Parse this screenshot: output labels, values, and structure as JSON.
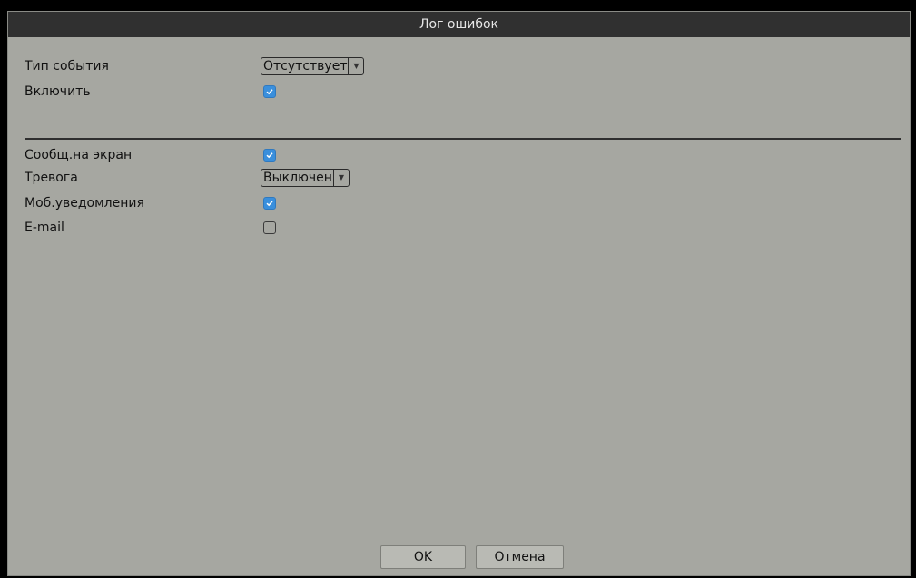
{
  "window": {
    "title": "Лог ошибок"
  },
  "settings_top": {
    "event_type": {
      "label": "Тип события",
      "value": "Отсутствует"
    },
    "enable": {
      "label": "Включить",
      "checked": true
    }
  },
  "settings_bottom": {
    "show_message": {
      "label": "Сообщ.на экран",
      "checked": true
    },
    "alarm": {
      "label": "Тревога",
      "value": "Выключен"
    },
    "mobile_notify": {
      "label": "Моб.уведомления",
      "checked": true
    },
    "email": {
      "label": "E-mail",
      "checked": false
    }
  },
  "buttons": {
    "ok_label": "OK",
    "cancel_label": "Отмена"
  },
  "colors": {
    "panel_bg": "#a6a7a1",
    "titlebar_bg": "#303030",
    "checkbox_on": "#3a8fdc"
  },
  "icons": {
    "checkbox_checked": "check-icon",
    "dropdown": "chevron-down-icon"
  }
}
